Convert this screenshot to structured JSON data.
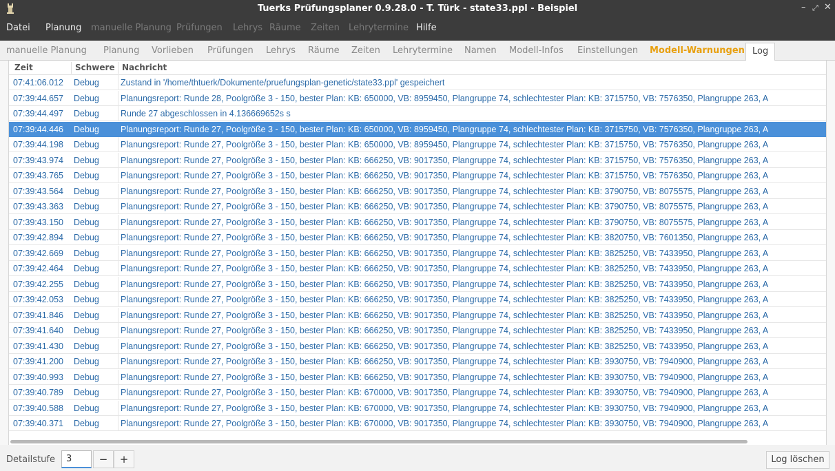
{
  "window": {
    "title": "Tuerks Prüfungsplaner 0.9.28.0 - T. Türk - state33.ppl - Beispiel",
    "app_icon": "app-tower-icon",
    "controls": {
      "minimize": "–",
      "maximize": "⤢",
      "close": "✕"
    }
  },
  "menu": [
    {
      "label": "Datei",
      "enabled": true
    },
    {
      "label": "Planung",
      "enabled": true
    },
    {
      "label": "manuelle Planung",
      "enabled": false
    },
    {
      "label": "Prüfungen",
      "enabled": false
    },
    {
      "label": "Lehrys",
      "enabled": false
    },
    {
      "label": "Räume",
      "enabled": false
    },
    {
      "label": "Zeiten",
      "enabled": false
    },
    {
      "label": "Lehrytermine",
      "enabled": false
    },
    {
      "label": "Hilfe",
      "enabled": true
    }
  ],
  "tabs": [
    {
      "label": "manuelle Planung"
    },
    {
      "label": "Planung"
    },
    {
      "label": "Vorlieben"
    },
    {
      "label": "Prüfungen"
    },
    {
      "label": "Lehrys"
    },
    {
      "label": "Räume"
    },
    {
      "label": "Zeiten"
    },
    {
      "label": "Lehrytermine"
    },
    {
      "label": "Namen"
    },
    {
      "label": "Modell-Infos"
    },
    {
      "label": "Einstellungen"
    },
    {
      "label": "Modell-Warnungen",
      "warning": true
    },
    {
      "label": "Log",
      "active": true
    }
  ],
  "colors": {
    "accent": "#4a90d9",
    "warning_tab": "#e8a010",
    "log_text": "#2b6aa8",
    "titlebar": "#3c3c3c"
  },
  "log": {
    "columns": [
      "Zeit",
      "Schwere",
      "Nachricht"
    ],
    "rows": [
      {
        "zeit": "07:41:06.012",
        "schwere": "Debug",
        "nachricht": "Zustand in '/home/thtuerk/Dokumente/pruefungsplan-genetic/state33.ppl' gespeichert"
      },
      {
        "zeit": "07:39:44.657",
        "schwere": "Debug",
        "nachricht": "Planungsreport: Runde 28, Poolgröße 3 - 150, bester Plan: KB: 650000, VB: 8959450, Plangruppe 74, schlechtester Plan: KB: 3715750, VB: 7576350, Plangruppe 263, A"
      },
      {
        "zeit": "07:39:44.497",
        "schwere": "Debug",
        "nachricht": "Runde 27 abgeschlossen in 4.136669652s s"
      },
      {
        "zeit": "07:39:44.446",
        "schwere": "Debug",
        "nachricht": "Planungsreport: Runde 27, Poolgröße 3 - 150, bester Plan: KB: 650000, VB: 8959450, Plangruppe 74, schlechtester Plan: KB: 3715750, VB: 7576350, Plangruppe 263, A",
        "selected": true
      },
      {
        "zeit": "07:39:44.198",
        "schwere": "Debug",
        "nachricht": "Planungsreport: Runde 27, Poolgröße 3 - 150, bester Plan: KB: 650000, VB: 8959450, Plangruppe 74, schlechtester Plan: KB: 3715750, VB: 7576350, Plangruppe 263, A"
      },
      {
        "zeit": "07:39:43.974",
        "schwere": "Debug",
        "nachricht": "Planungsreport: Runde 27, Poolgröße 3 - 150, bester Plan: KB: 666250, VB: 9017350, Plangruppe 74, schlechtester Plan: KB: 3715750, VB: 7576350, Plangruppe 263, A"
      },
      {
        "zeit": "07:39:43.765",
        "schwere": "Debug",
        "nachricht": "Planungsreport: Runde 27, Poolgröße 3 - 150, bester Plan: KB: 666250, VB: 9017350, Plangruppe 74, schlechtester Plan: KB: 3715750, VB: 7576350, Plangruppe 263, A"
      },
      {
        "zeit": "07:39:43.564",
        "schwere": "Debug",
        "nachricht": "Planungsreport: Runde 27, Poolgröße 3 - 150, bester Plan: KB: 666250, VB: 9017350, Plangruppe 74, schlechtester Plan: KB: 3790750, VB: 8075575, Plangruppe 263, A"
      },
      {
        "zeit": "07:39:43.363",
        "schwere": "Debug",
        "nachricht": "Planungsreport: Runde 27, Poolgröße 3 - 150, bester Plan: KB: 666250, VB: 9017350, Plangruppe 74, schlechtester Plan: KB: 3790750, VB: 8075575, Plangruppe 263, A"
      },
      {
        "zeit": "07:39:43.150",
        "schwere": "Debug",
        "nachricht": "Planungsreport: Runde 27, Poolgröße 3 - 150, bester Plan: KB: 666250, VB: 9017350, Plangruppe 74, schlechtester Plan: KB: 3790750, VB: 8075575, Plangruppe 263, A"
      },
      {
        "zeit": "07:39:42.894",
        "schwere": "Debug",
        "nachricht": "Planungsreport: Runde 27, Poolgröße 3 - 150, bester Plan: KB: 666250, VB: 9017350, Plangruppe 74, schlechtester Plan: KB: 3820750, VB: 7601350, Plangruppe 263, A"
      },
      {
        "zeit": "07:39:42.669",
        "schwere": "Debug",
        "nachricht": "Planungsreport: Runde 27, Poolgröße 3 - 150, bester Plan: KB: 666250, VB: 9017350, Plangruppe 74, schlechtester Plan: KB: 3825250, VB: 7433950, Plangruppe 263, A"
      },
      {
        "zeit": "07:39:42.464",
        "schwere": "Debug",
        "nachricht": "Planungsreport: Runde 27, Poolgröße 3 - 150, bester Plan: KB: 666250, VB: 9017350, Plangruppe 74, schlechtester Plan: KB: 3825250, VB: 7433950, Plangruppe 263, A"
      },
      {
        "zeit": "07:39:42.255",
        "schwere": "Debug",
        "nachricht": "Planungsreport: Runde 27, Poolgröße 3 - 150, bester Plan: KB: 666250, VB: 9017350, Plangruppe 74, schlechtester Plan: KB: 3825250, VB: 7433950, Plangruppe 263, A"
      },
      {
        "zeit": "07:39:42.053",
        "schwere": "Debug",
        "nachricht": "Planungsreport: Runde 27, Poolgröße 3 - 150, bester Plan: KB: 666250, VB: 9017350, Plangruppe 74, schlechtester Plan: KB: 3825250, VB: 7433950, Plangruppe 263, A"
      },
      {
        "zeit": "07:39:41.846",
        "schwere": "Debug",
        "nachricht": "Planungsreport: Runde 27, Poolgröße 3 - 150, bester Plan: KB: 666250, VB: 9017350, Plangruppe 74, schlechtester Plan: KB: 3825250, VB: 7433950, Plangruppe 263, A"
      },
      {
        "zeit": "07:39:41.640",
        "schwere": "Debug",
        "nachricht": "Planungsreport: Runde 27, Poolgröße 3 - 150, bester Plan: KB: 666250, VB: 9017350, Plangruppe 74, schlechtester Plan: KB: 3825250, VB: 7433950, Plangruppe 263, A"
      },
      {
        "zeit": "07:39:41.430",
        "schwere": "Debug",
        "nachricht": "Planungsreport: Runde 27, Poolgröße 3 - 150, bester Plan: KB: 666250, VB: 9017350, Plangruppe 74, schlechtester Plan: KB: 3825250, VB: 7433950, Plangruppe 263, A"
      },
      {
        "zeit": "07:39:41.200",
        "schwere": "Debug",
        "nachricht": "Planungsreport: Runde 27, Poolgröße 3 - 150, bester Plan: KB: 666250, VB: 9017350, Plangruppe 74, schlechtester Plan: KB: 3930750, VB: 7940900, Plangruppe 263, A"
      },
      {
        "zeit": "07:39:40.993",
        "schwere": "Debug",
        "nachricht": "Planungsreport: Runde 27, Poolgröße 3 - 150, bester Plan: KB: 666250, VB: 9017350, Plangruppe 74, schlechtester Plan: KB: 3930750, VB: 7940900, Plangruppe 263, A"
      },
      {
        "zeit": "07:39:40.789",
        "schwere": "Debug",
        "nachricht": "Planungsreport: Runde 27, Poolgröße 3 - 150, bester Plan: KB: 670000, VB: 9017350, Plangruppe 74, schlechtester Plan: KB: 3930750, VB: 7940900, Plangruppe 263, A"
      },
      {
        "zeit": "07:39:40.588",
        "schwere": "Debug",
        "nachricht": "Planungsreport: Runde 27, Poolgröße 3 - 150, bester Plan: KB: 670000, VB: 9017350, Plangruppe 74, schlechtester Plan: KB: 3930750, VB: 7940900, Plangruppe 263, A"
      },
      {
        "zeit": "07:39:40.371",
        "schwere": "Debug",
        "nachricht": "Planungsreport: Runde 27, Poolgröße 3 - 150, bester Plan: KB: 670000, VB: 9017350, Plangruppe 74, schlechtester Plan: KB: 3930750, VB: 7940900, Plangruppe 263, A"
      }
    ]
  },
  "footer": {
    "detail_label": "Detailstufe",
    "detail_value": "3",
    "minus_label": "−",
    "plus_label": "+",
    "clear_label": "Log löschen"
  }
}
